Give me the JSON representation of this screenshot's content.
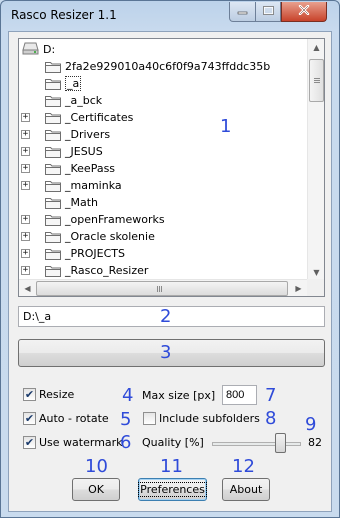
{
  "window": {
    "title": "Rasco Resizer 1.1"
  },
  "tree": {
    "root_label": "D:",
    "items": [
      {
        "label": "2fa2e929010a40c6f0f9a743ffddc35b",
        "expandable": false,
        "selected": false
      },
      {
        "label": "_a",
        "expandable": false,
        "selected": true
      },
      {
        "label": "_a_bck",
        "expandable": false,
        "selected": false
      },
      {
        "label": "_Certificates",
        "expandable": true,
        "selected": false
      },
      {
        "label": "_Drivers",
        "expandable": true,
        "selected": false
      },
      {
        "label": "_JESUS",
        "expandable": true,
        "selected": false
      },
      {
        "label": "_KeePass",
        "expandable": true,
        "selected": false
      },
      {
        "label": "_maminka",
        "expandable": true,
        "selected": false
      },
      {
        "label": "_Math",
        "expandable": false,
        "selected": false
      },
      {
        "label": "_openFrameworks",
        "expandable": true,
        "selected": false
      },
      {
        "label": "_Oracle skolenie",
        "expandable": true,
        "selected": false
      },
      {
        "label": "_PROJECTS",
        "expandable": true,
        "selected": false
      },
      {
        "label": "_Rasco_Resizer",
        "expandable": true,
        "selected": false
      }
    ]
  },
  "path_field": {
    "value": "D:\\_a"
  },
  "options": {
    "resize": {
      "label": "Resize",
      "checked": true
    },
    "auto_rotate": {
      "label": "Auto - rotate",
      "checked": true
    },
    "use_watermark": {
      "label": "Use watermark",
      "checked": true
    },
    "max_size_label": "Max size [px]",
    "max_size_value": "800",
    "include_subfolders": {
      "label": "Include subfolders",
      "checked": false
    },
    "quality_label": "Quality [%]",
    "quality_value": "82"
  },
  "buttons": {
    "ok": "OK",
    "preferences": "Preferences",
    "about": "About"
  },
  "annotations": [
    "1",
    "2",
    "3",
    "4",
    "5",
    "6",
    "7",
    "8",
    "9",
    "10",
    "11",
    "12"
  ],
  "colors": {
    "annotation": "#2f4bd9",
    "title_bar": "#bcd2ea"
  },
  "icons": [
    "drive-icon",
    "folder-icon",
    "minimize-icon",
    "maximize-icon",
    "close-icon"
  ]
}
